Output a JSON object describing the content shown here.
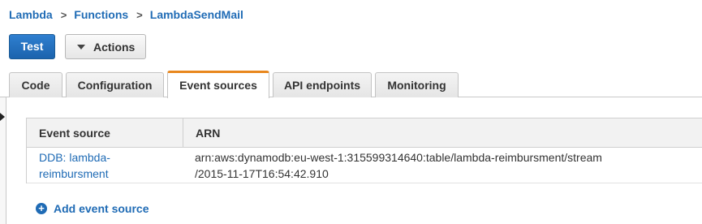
{
  "breadcrumb": {
    "items": [
      "Lambda",
      "Functions",
      "LambdaSendMail"
    ],
    "separator": ">"
  },
  "toolbar": {
    "test_label": "Test",
    "actions_label": "Actions"
  },
  "tabs": [
    {
      "label": "Code",
      "active": false
    },
    {
      "label": "Configuration",
      "active": false
    },
    {
      "label": "Event sources",
      "active": true
    },
    {
      "label": "API endpoints",
      "active": false
    },
    {
      "label": "Monitoring",
      "active": false
    }
  ],
  "table": {
    "columns": [
      "Event source",
      "ARN"
    ],
    "rows": [
      {
        "source_line1": "DDB: lambda-",
        "source_line2": "reimbursment",
        "arn_line1": "arn:aws:dynamodb:eu-west-1:315599314640:table/lambda-reimbursment/stream",
        "arn_line2": "/2015-11-17T16:54:42.910"
      }
    ]
  },
  "add_event_source_label": "Add event source",
  "colors": {
    "link": "#1f6bb5",
    "primary_button": "#1b63ad",
    "active_tab_accent": "#e8871e"
  }
}
